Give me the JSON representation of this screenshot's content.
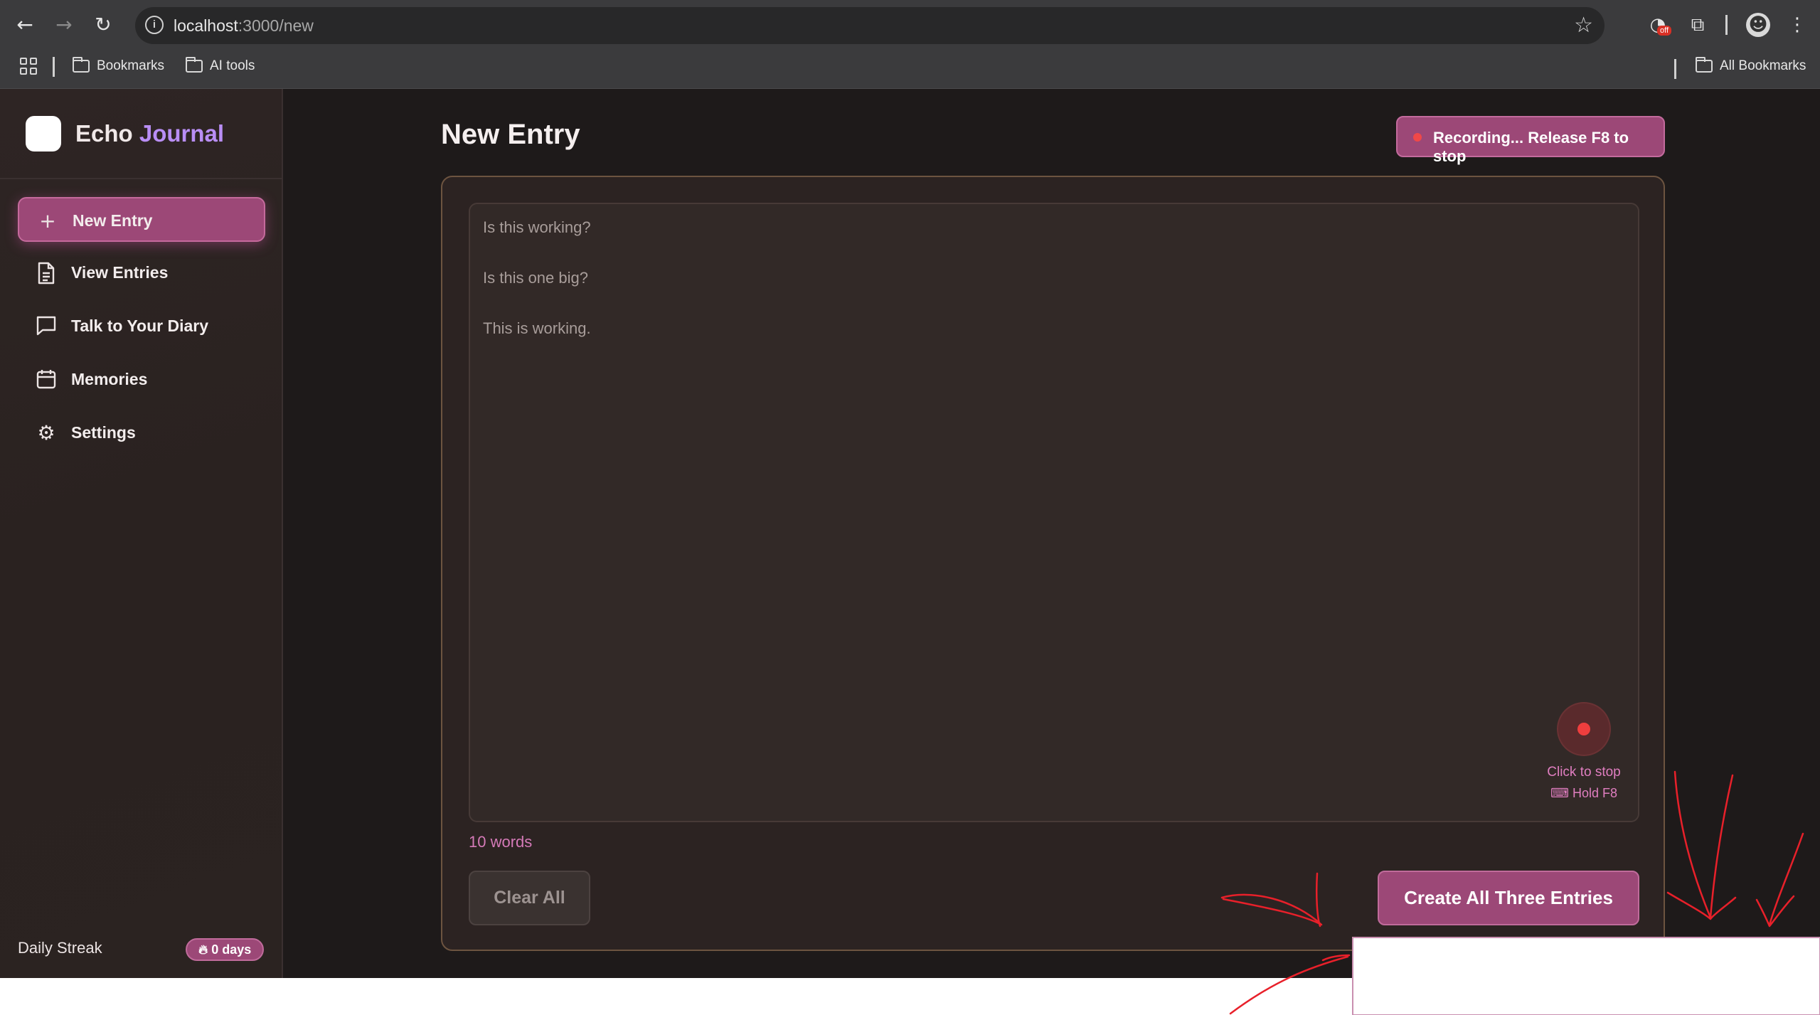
{
  "browser": {
    "url_host": "localhost",
    "url_path": ":3000/new",
    "extension_badge": "off",
    "bookmarks": [
      "Bookmarks",
      "AI tools"
    ],
    "all_bookmarks": "All Bookmarks"
  },
  "app": {
    "brand_first": "Echo",
    "brand_second": "Journal",
    "nav": [
      {
        "label": "New Entry",
        "icon": "plus-icon",
        "active": true
      },
      {
        "label": "View Entries",
        "icon": "document-icon",
        "active": false
      },
      {
        "label": "Talk to Your Diary",
        "icon": "chat-bubble-icon",
        "active": false
      },
      {
        "label": "Memories",
        "icon": "calendar-icon",
        "active": false
      },
      {
        "label": "Settings",
        "icon": "gear-icon",
        "active": false
      }
    ],
    "streak": {
      "label": "Daily Streak",
      "value": "0 days"
    }
  },
  "main": {
    "title": "New Entry",
    "recording_status": "Recording... Release F8 to stop",
    "entry_lines": [
      "Is this working?",
      "Is this one big?",
      "This is working."
    ],
    "mic_hint_primary": "Click to stop",
    "mic_hint_secondary": "Hold F8",
    "word_count": "10 words",
    "clear_label": "Clear All",
    "create_label": "Create All Three Entries"
  },
  "colors": {
    "accent": "#9c4877",
    "accent_text": "#d57ab8",
    "recording_dot": "#ef3e3e",
    "annotation": "#e8202a"
  }
}
